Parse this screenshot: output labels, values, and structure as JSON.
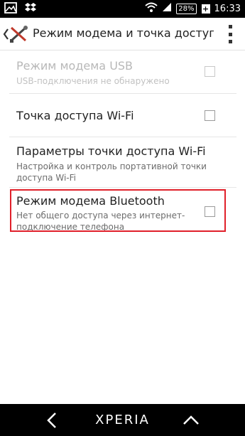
{
  "status_bar": {
    "battery": "28%",
    "time": "16:33"
  },
  "action_bar": {
    "title": "Режим модема и точка доступа"
  },
  "settings": [
    {
      "title": "Режим модема USB",
      "summary": "USB-подключения не обнаружено",
      "enabled": false,
      "checked": false
    },
    {
      "title": "Точка доступа Wi-Fi",
      "summary": "",
      "enabled": true,
      "checked": false
    },
    {
      "title": "Параметры точки доступа Wi-Fi",
      "summary_line1": "Настройка и контроль портативной точки",
      "summary_line2": "доступа Wi-Fi",
      "enabled": true
    },
    {
      "title": "Режим модема Bluetooth",
      "summary_line1": "Нет общего доступа через интернет-",
      "summary_line2": "подключение телефона",
      "enabled": true,
      "checked": false,
      "highlighted": true
    }
  ],
  "nav_bar": {
    "brand": "XPERIA"
  },
  "colors": {
    "highlight": "#e0202a",
    "status_bar": "#000000",
    "nav_bar": "#000000"
  }
}
